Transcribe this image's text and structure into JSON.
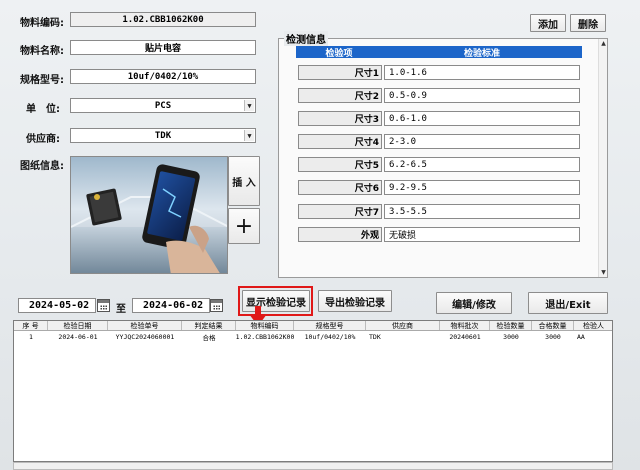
{
  "form": {
    "material_code_label": "物料编码:",
    "material_code_value": "1.02.CBB1062K00",
    "material_name_label": "物料名称:",
    "material_name_value": "贴片电容",
    "spec_label": "规格型号:",
    "spec_value": "10uf/0402/10%",
    "unit_label": "单　位:",
    "unit_value": "PCS",
    "supplier_label": "供应商:",
    "supplier_value": "TDK",
    "drawing_label": "图纸信息:",
    "insert_label": "插 入",
    "plus_label": "+"
  },
  "top_buttons": {
    "add": "添加",
    "delete": "删除"
  },
  "inspection": {
    "title": "检测信息",
    "col_item": "检验项",
    "col_standard": "检验标准",
    "rows": [
      {
        "name": "尺寸1",
        "value": "1.0-1.6"
      },
      {
        "name": "尺寸2",
        "value": "0.5-0.9"
      },
      {
        "name": "尺寸3",
        "value": "0.6-1.0"
      },
      {
        "name": "尺寸4",
        "value": "2-3.0"
      },
      {
        "name": "尺寸5",
        "value": "6.2-6.5"
      },
      {
        "name": "尺寸6",
        "value": "9.2-9.5"
      },
      {
        "name": "尺寸7",
        "value": "3.5-5.5"
      },
      {
        "name": "外观",
        "value": "无破损"
      }
    ]
  },
  "query": {
    "date_from": "2024-05-02",
    "date_to_label": "至",
    "date_to": "2024-06-02",
    "show_records": "显示检验记录",
    "export_records": "导出检验记录",
    "edit": "编辑/修改",
    "exit": "退出/Exit"
  },
  "table": {
    "headers": [
      "序 号",
      "检验日期",
      "检验单号",
      "判定结果",
      "物料编码",
      "规格型号",
      "供应商",
      "物料批次",
      "检验数量",
      "合格数量",
      "检验人"
    ],
    "rows": [
      [
        "1",
        "2024-06-01",
        "YYJQC2024060001",
        "合格",
        "1.02.CBB1062K00",
        "10uf/0402/10%",
        "TDK",
        "20240601",
        "3000",
        "3000",
        "AA"
      ]
    ]
  },
  "colors": {
    "header_blue": "#1c65c9",
    "highlight_red": "#e01818"
  }
}
